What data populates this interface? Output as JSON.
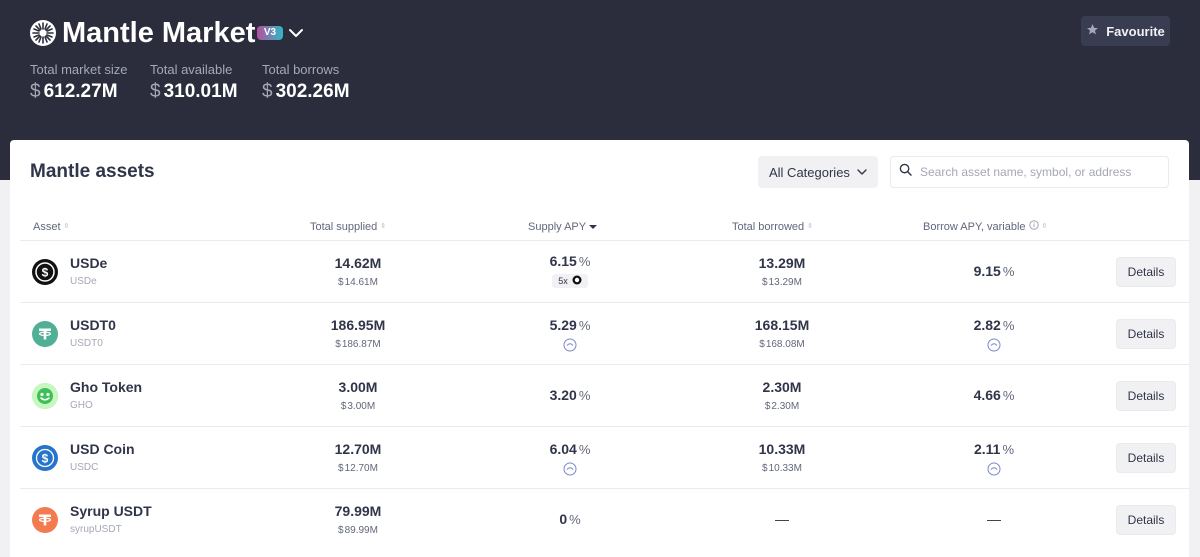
{
  "market": {
    "title": "Mantle Market",
    "version": "V3",
    "favourite_label": "Favourite",
    "stats": [
      {
        "label": "Total market size",
        "currency": "$",
        "value": "612.27M"
      },
      {
        "label": "Total available",
        "currency": "$",
        "value": "310.01M"
      },
      {
        "label": "Total borrows",
        "currency": "$",
        "value": "302.26M"
      }
    ]
  },
  "assets_card": {
    "title": "Mantle assets",
    "category_select": "All Categories",
    "search_placeholder": "Search asset name, symbol, or address",
    "columns": {
      "asset": "Asset",
      "total_supplied": "Total supplied",
      "supply_apy": "Supply APY",
      "total_borrowed": "Total borrowed",
      "borrow_apy": "Borrow APY, variable"
    },
    "percent_sign": "%",
    "details_label": "Details",
    "rows": [
      {
        "name": "USDe",
        "symbol": "USDe",
        "icon": "usde-icon",
        "supplied": "14.62M",
        "supplied_usd": "14.61M",
        "supply_apy": "6.15",
        "supply_extra": "5x",
        "borrowed": "13.29M",
        "borrowed_usd": "13.29M",
        "borrow_apy": "9.15"
      },
      {
        "name": "USDT0",
        "symbol": "USDT0",
        "icon": "usdt0-icon",
        "supplied": "186.95M",
        "supplied_usd": "186.87M",
        "supply_apy": "5.29",
        "borrowed": "168.15M",
        "borrowed_usd": "168.08M",
        "borrow_apy": "2.82"
      },
      {
        "name": "Gho Token",
        "symbol": "GHO",
        "icon": "gho-icon",
        "supplied": "3.00M",
        "supplied_usd": "3.00M",
        "supply_apy": "3.20",
        "borrowed": "2.30M",
        "borrowed_usd": "2.30M",
        "borrow_apy": "4.66"
      },
      {
        "name": "USD Coin",
        "symbol": "USDC",
        "icon": "usdc-icon",
        "supplied": "12.70M",
        "supplied_usd": "12.70M",
        "supply_apy": "6.04",
        "borrowed": "10.33M",
        "borrowed_usd": "10.33M",
        "borrow_apy": "2.11"
      },
      {
        "name": "Syrup USDT",
        "symbol": "syrupUSDT",
        "icon": "syrup-usdt-icon",
        "supplied": "79.99M",
        "supplied_usd": "89.99M",
        "supply_apy": "0",
        "borrowed": "—",
        "borrow_apy": "—"
      }
    ],
    "currency": "$"
  }
}
